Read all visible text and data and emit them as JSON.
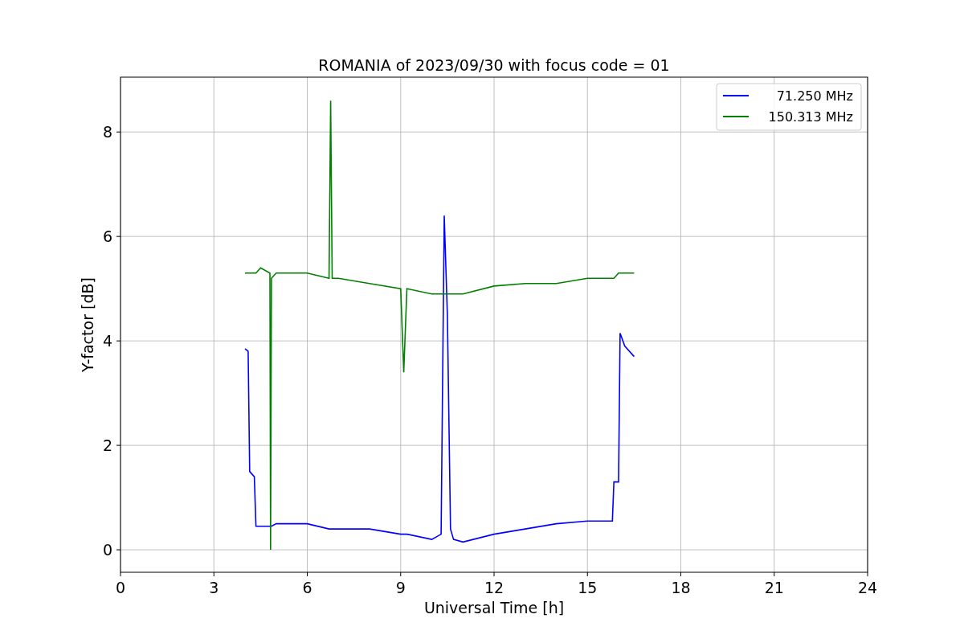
{
  "chart_data": {
    "type": "line",
    "title": "ROMANIA of 2023/09/30 with focus code = 01",
    "xlabel": "Universal Time [h]",
    "ylabel": "Y-factor [dB]",
    "x": [
      4,
      4.1,
      4.15,
      4.3,
      4.35,
      4.5,
      4.8,
      4.82,
      4.85,
      5,
      6,
      6.7,
      6.75,
      6.8,
      7,
      8,
      9,
      9.1,
      9.2,
      10,
      10.3,
      10.4,
      10.5,
      10.6,
      10.7,
      11,
      12,
      13,
      14,
      15,
      15.8,
      15.85,
      16,
      16.05,
      16.2,
      16.5
    ],
    "series": [
      {
        "name": "71.250 MHz",
        "color": "#0000ff",
        "values": [
          3.85,
          3.8,
          1.5,
          1.4,
          0.45,
          0.45,
          0.45,
          0.45,
          0.45,
          0.5,
          0.5,
          0.4,
          0.4,
          0.4,
          0.4,
          0.4,
          0.3,
          0.3,
          0.3,
          0.2,
          0.3,
          6.4,
          4.5,
          0.4,
          0.2,
          0.15,
          0.3,
          0.4,
          0.5,
          0.55,
          0.55,
          1.3,
          1.3,
          4.15,
          3.9,
          3.7
        ]
      },
      {
        "name": "150.313 MHz",
        "color": "#008000",
        "values": [
          5.3,
          5.3,
          5.3,
          5.3,
          5.3,
          5.4,
          5.3,
          0,
          5.2,
          5.3,
          5.3,
          5.2,
          8.6,
          5.2,
          5.2,
          5.1,
          5.0,
          3.4,
          5.0,
          4.9,
          4.9,
          4.9,
          4.9,
          4.9,
          4.9,
          4.9,
          5.05,
          5.1,
          5.1,
          5.2,
          5.2,
          5.2,
          5.3,
          5.3,
          5.3,
          5.3
        ]
      }
    ],
    "xlim": [
      0,
      24
    ],
    "ylim": [
      -0.43,
      9.05
    ],
    "xticks": [
      0,
      3,
      6,
      9,
      12,
      15,
      18,
      21,
      24
    ],
    "yticks": [
      0,
      2,
      4,
      6,
      8
    ],
    "grid": true,
    "legend": true
  }
}
